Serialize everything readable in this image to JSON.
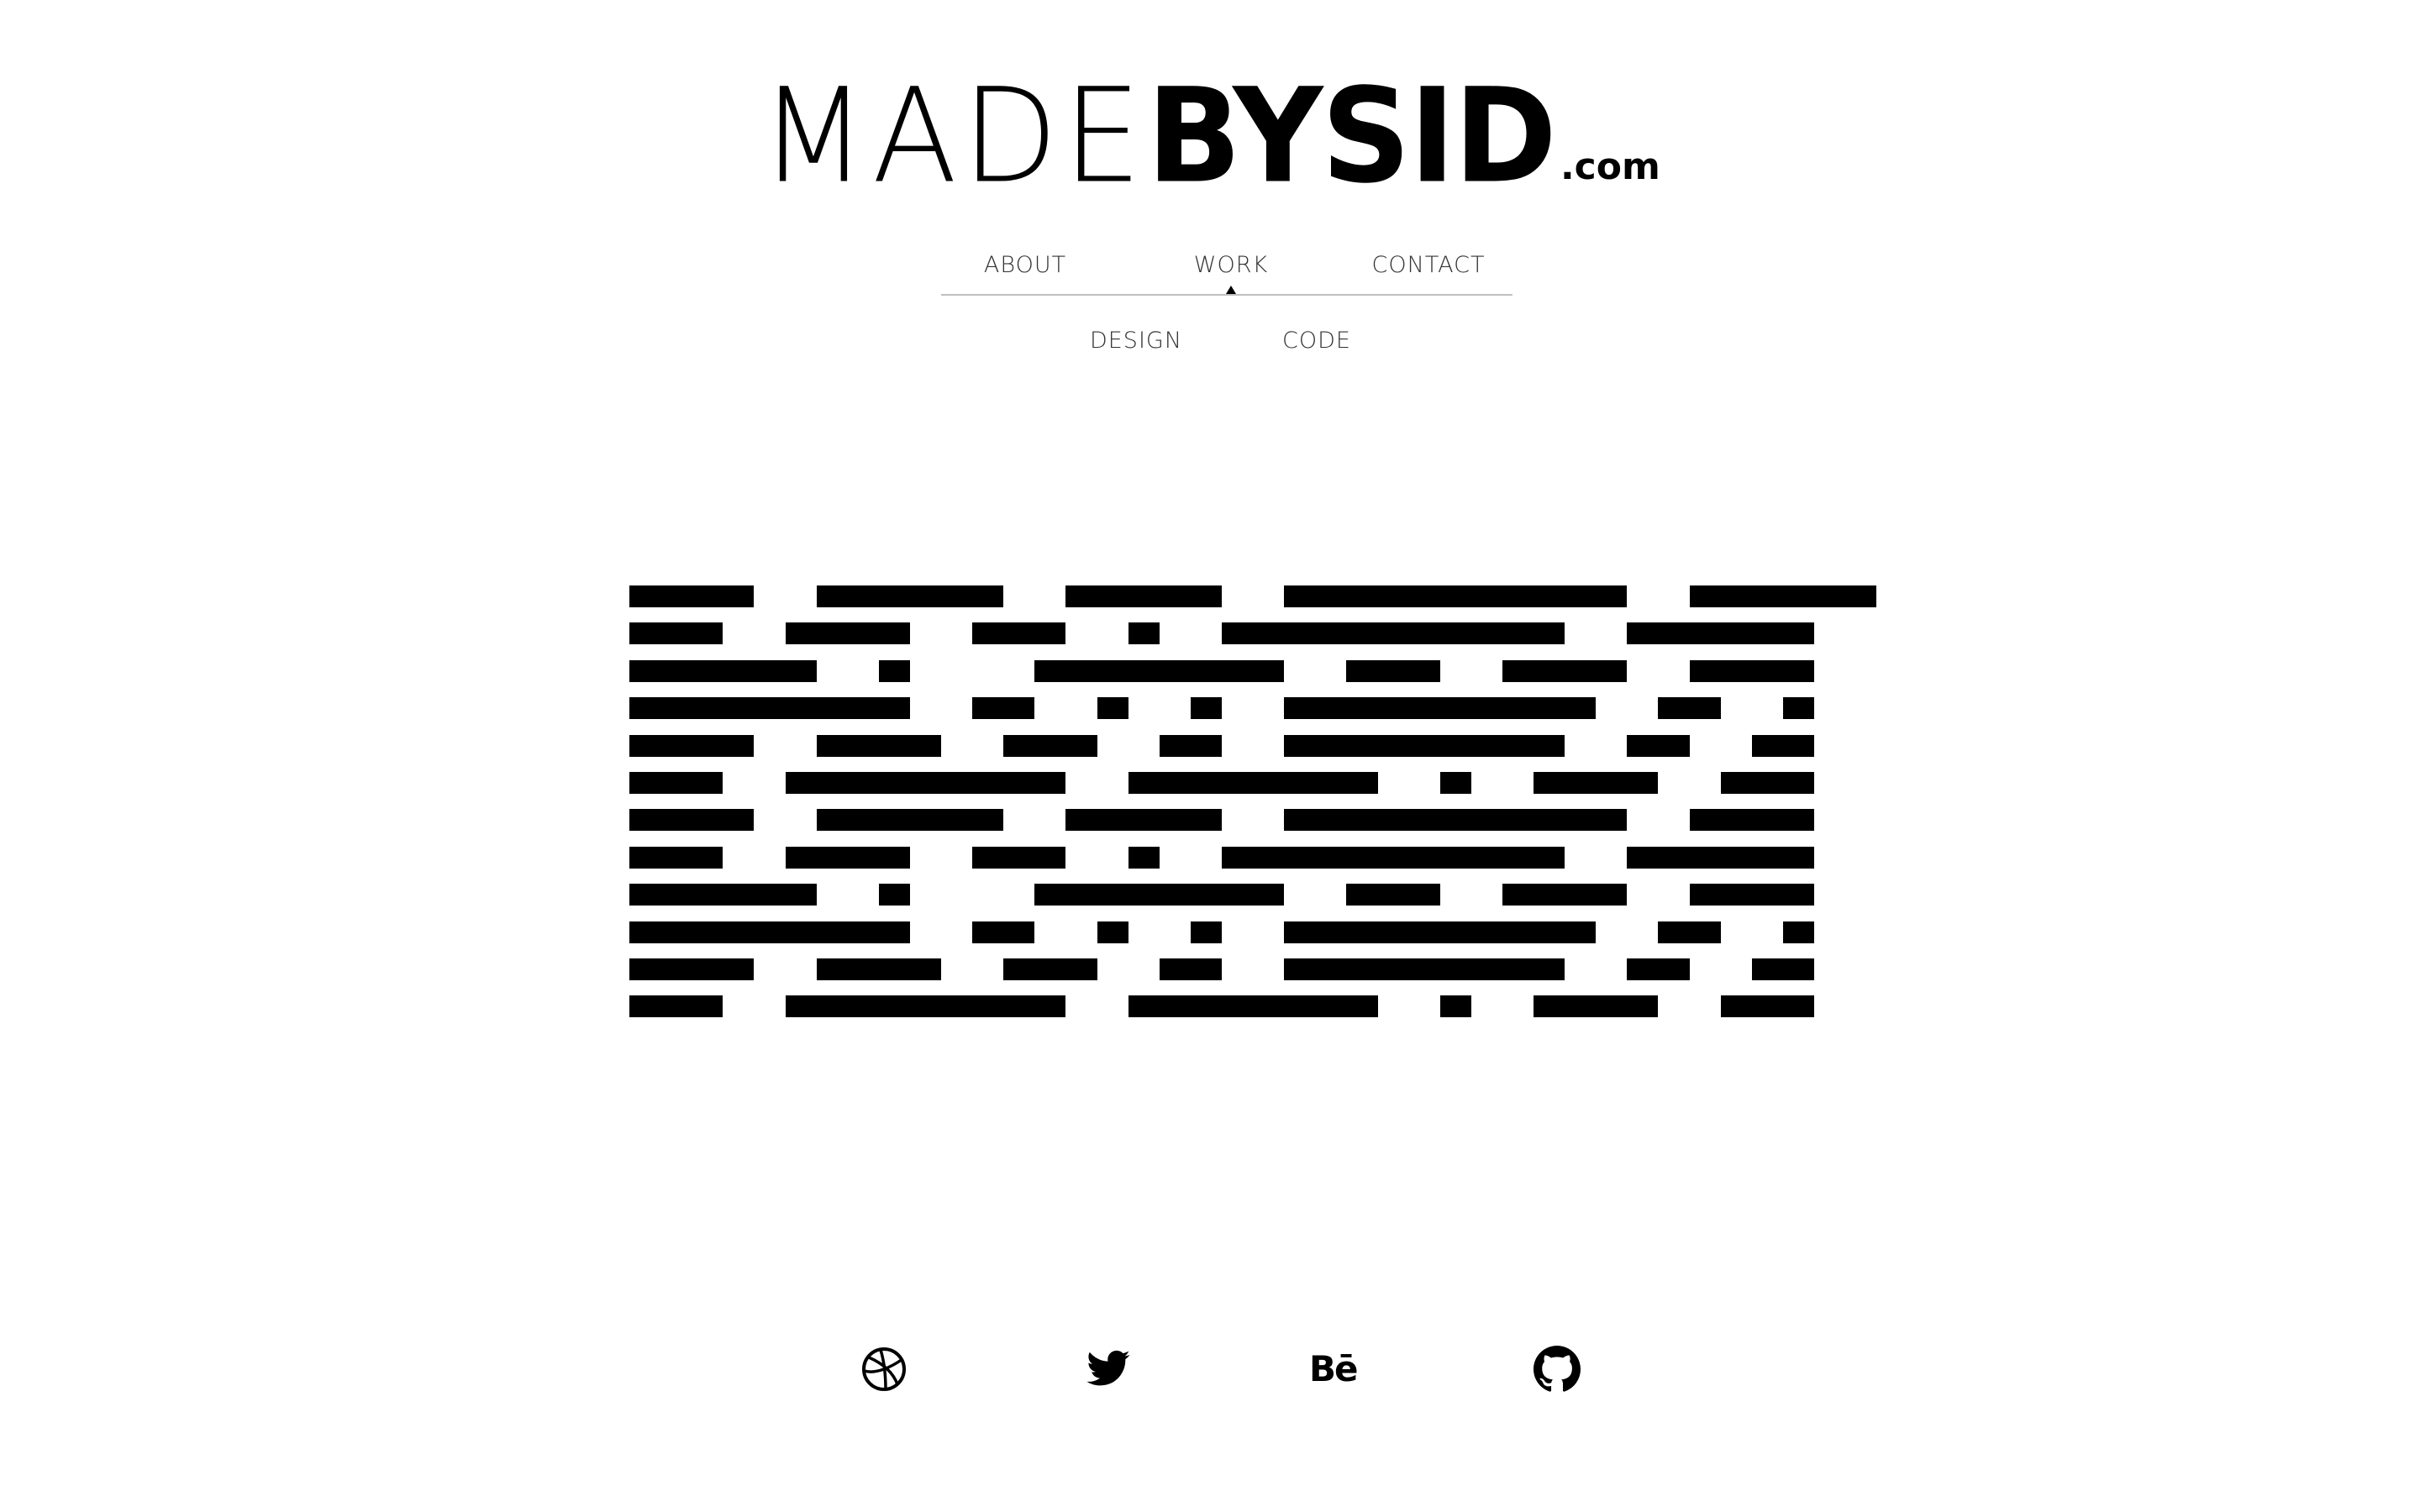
{
  "logo": {
    "part_light": "MADE",
    "part_bold": "BYSID",
    "part_tld": ".com"
  },
  "nav": {
    "items": [
      {
        "label": "ABOUT"
      },
      {
        "label": "WORK",
        "active": true
      },
      {
        "label": "CONTACT"
      }
    ],
    "sub_items": [
      {
        "label": "DESIGN"
      },
      {
        "label": "CODE"
      }
    ]
  },
  "social": {
    "icons": [
      "dribbble-icon",
      "twitter-icon",
      "behance-icon",
      "github-icon"
    ],
    "behance_glyph": "Bē"
  },
  "colors": {
    "background": "#ffffff",
    "foreground": "#000000",
    "nav_text": "#333333",
    "nav_rule": "#bfbfbf"
  },
  "pattern": {
    "rows": [
      [
        [
          0,
          4
        ],
        [
          6,
          12
        ],
        [
          14,
          19
        ],
        [
          21,
          32
        ],
        [
          34,
          40
        ]
      ],
      [
        [
          0,
          3
        ],
        [
          5,
          9
        ],
        [
          11,
          14
        ],
        [
          16,
          17
        ],
        [
          19,
          30
        ],
        [
          32,
          38
        ]
      ],
      [
        [
          0,
          6
        ],
        [
          8,
          9
        ],
        [
          13,
          21
        ],
        [
          23,
          26
        ],
        [
          28,
          32
        ],
        [
          34,
          38
        ]
      ],
      [
        [
          0,
          9
        ],
        [
          11,
          13
        ],
        [
          15,
          16
        ],
        [
          18,
          19
        ],
        [
          21,
          31
        ],
        [
          33,
          35
        ],
        [
          37,
          38
        ]
      ],
      [
        [
          0,
          4
        ],
        [
          6,
          10
        ],
        [
          12,
          15
        ],
        [
          17,
          19
        ],
        [
          21,
          30
        ],
        [
          32,
          34
        ],
        [
          36,
          38
        ]
      ],
      [
        [
          0,
          3
        ],
        [
          5,
          14
        ],
        [
          16,
          24
        ],
        [
          26,
          27
        ],
        [
          29,
          33
        ],
        [
          35,
          38
        ]
      ],
      [
        [
          0,
          4
        ],
        [
          6,
          12
        ],
        [
          14,
          19
        ],
        [
          21,
          32
        ],
        [
          34,
          38
        ]
      ],
      [
        [
          0,
          3
        ],
        [
          5,
          9
        ],
        [
          11,
          14
        ],
        [
          16,
          17
        ],
        [
          19,
          30
        ],
        [
          32,
          38
        ]
      ],
      [
        [
          0,
          6
        ],
        [
          8,
          9
        ],
        [
          13,
          21
        ],
        [
          23,
          26
        ],
        [
          28,
          32
        ],
        [
          34,
          38
        ]
      ],
      [
        [
          0,
          9
        ],
        [
          11,
          13
        ],
        [
          15,
          16
        ],
        [
          18,
          19
        ],
        [
          21,
          31
        ],
        [
          33,
          35
        ],
        [
          37,
          38
        ]
      ],
      [
        [
          0,
          4
        ],
        [
          6,
          10
        ],
        [
          12,
          15
        ],
        [
          17,
          19
        ],
        [
          21,
          30
        ],
        [
          32,
          34
        ],
        [
          36,
          38
        ]
      ],
      [
        [
          0,
          3
        ],
        [
          5,
          14
        ],
        [
          16,
          24
        ],
        [
          26,
          27
        ],
        [
          29,
          33
        ],
        [
          35,
          38
        ]
      ]
    ]
  }
}
